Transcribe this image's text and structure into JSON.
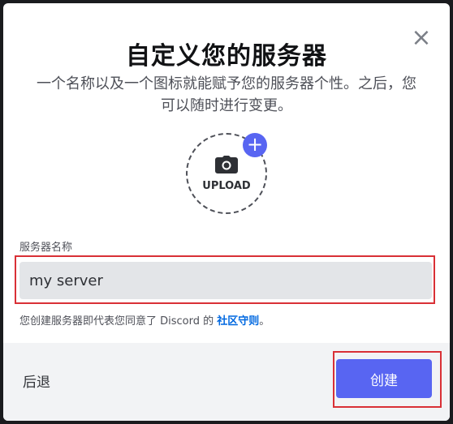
{
  "dialog": {
    "title": "自定义您的服务器",
    "subtitle": "一个名称以及一个图标就能赋予您的服务器个性。之后，您可以随时进行变更。",
    "close_symbol": "×"
  },
  "upload": {
    "label": "UPLOAD",
    "plus_symbol": "+"
  },
  "server_name": {
    "label": "服务器名称",
    "value": "my server"
  },
  "terms": {
    "prefix": "您创建服务器即代表您同意了 Discord 的",
    "link": "社区守则",
    "suffix": "。"
  },
  "footer": {
    "back_label": "后退",
    "create_label": "创建"
  },
  "colors": {
    "accent": "#5865f2",
    "highlight": "#d93036"
  }
}
